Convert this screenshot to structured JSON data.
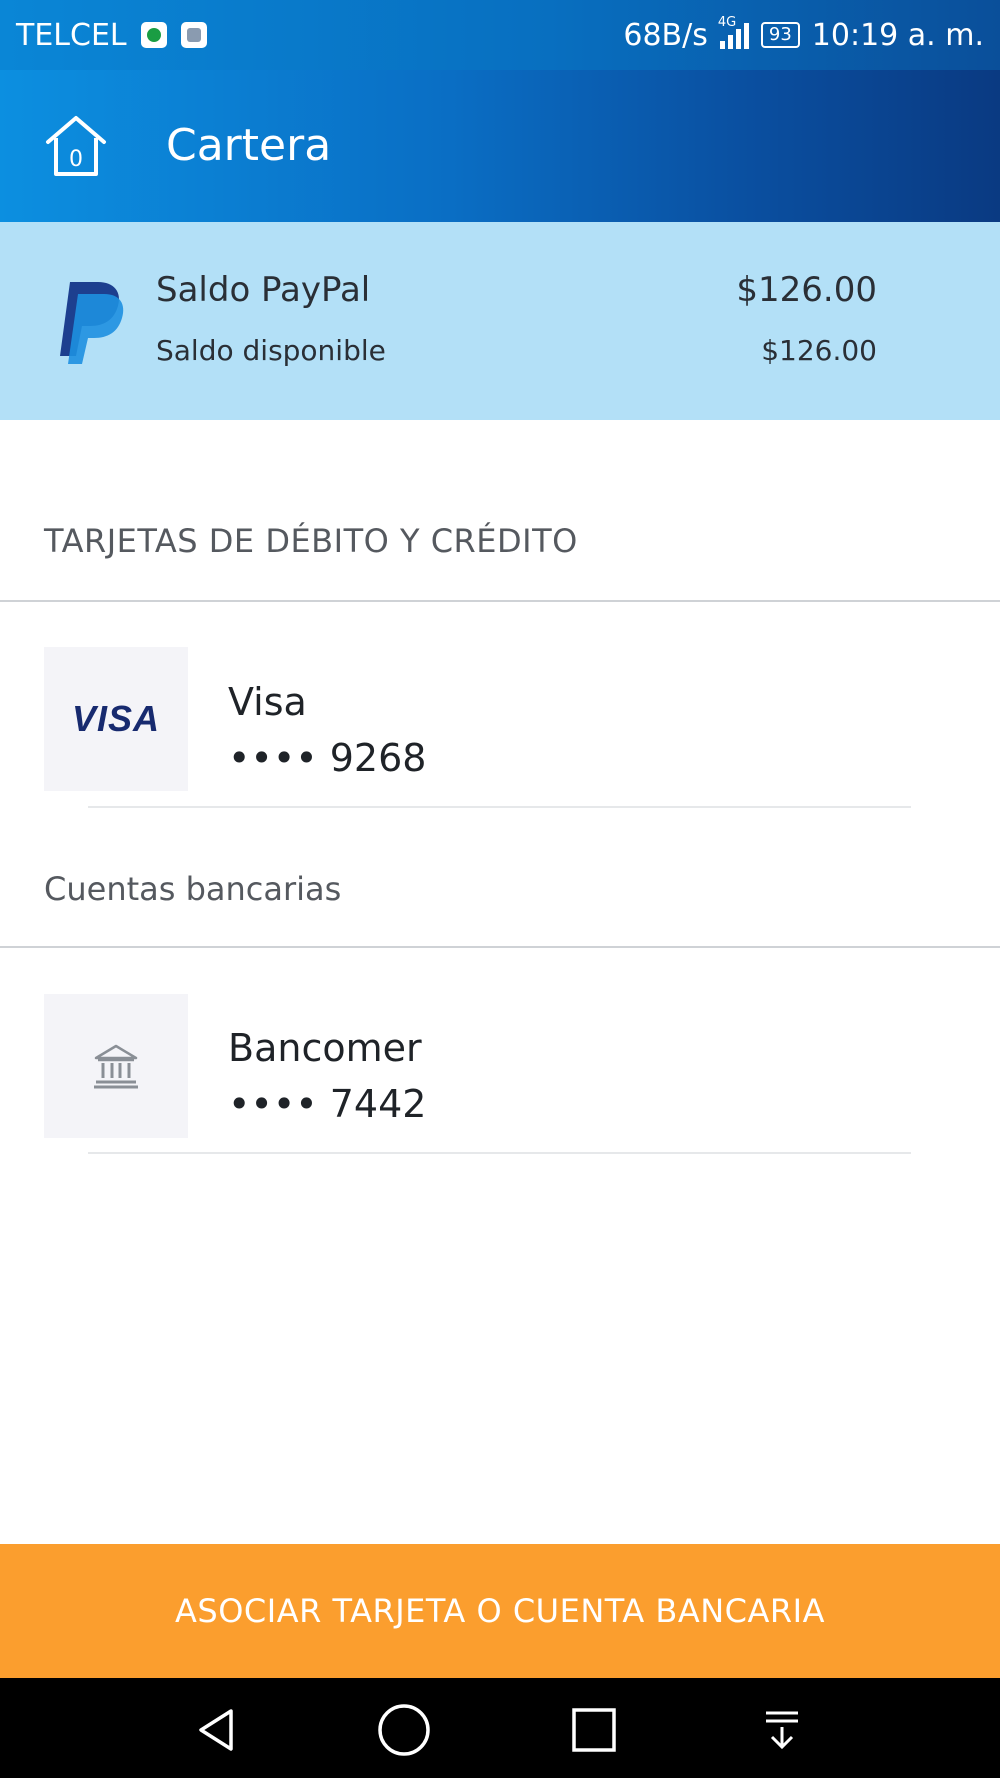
{
  "status_bar": {
    "carrier": "TELCEL",
    "net_speed": "68B/s",
    "network_type": "4G",
    "battery": "93",
    "time": "10:19 a. m.",
    "icons": [
      "whatsapp-icon",
      "notification-icon",
      "signal-icon",
      "battery-icon"
    ]
  },
  "header": {
    "title": "Cartera",
    "home_icon": "home-icon"
  },
  "balance": {
    "title": "Saldo PayPal",
    "amount": "$126.00",
    "available_label": "Saldo disponible",
    "available_amount": "$126.00",
    "logo": "paypal-logo-icon"
  },
  "cards_section": {
    "header": "TARJETAS DE DÉBITO Y CRÉDITO",
    "items": [
      {
        "logo_text": "VISA",
        "name": "Visa",
        "number": "•••• 9268"
      }
    ]
  },
  "bank_section": {
    "header": "Cuentas bancarias",
    "items": [
      {
        "icon": "bank-icon",
        "name": "Bancomer",
        "number": "•••• 7442"
      }
    ]
  },
  "action_button": {
    "label": "ASOCIAR TARJETA O CUENTA BANCARIA"
  },
  "colors": {
    "header_blue": "#0a6ec4",
    "balance_bg": "#b3e0f7",
    "action_orange": "#fb9e2e",
    "nav_black": "#000000"
  },
  "nav_bar": {
    "buttons": [
      "back-icon",
      "home-circle-icon",
      "recents-icon",
      "notification-pull-icon"
    ]
  }
}
